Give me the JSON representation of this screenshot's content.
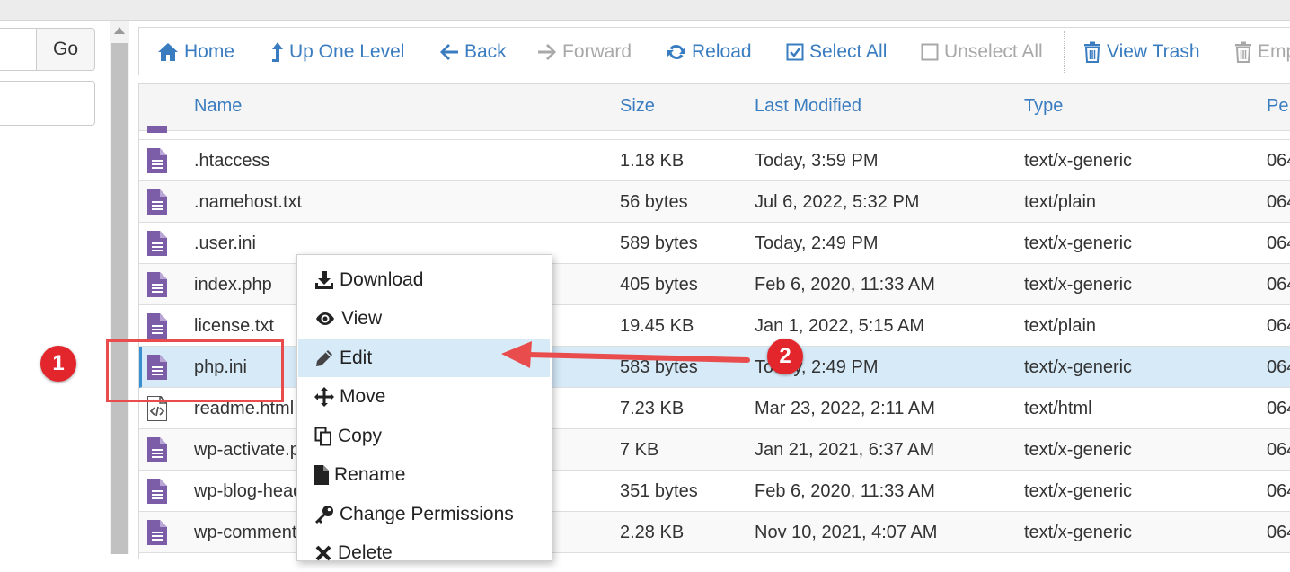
{
  "left_panel": {
    "go_label": "Go"
  },
  "toolbar": {
    "items": [
      {
        "label": "Home",
        "icon": "home-icon",
        "enabled": true
      },
      {
        "label": "Up One Level",
        "icon": "up-level-icon",
        "enabled": true
      },
      {
        "label": "Back",
        "icon": "back-arrow-icon",
        "enabled": true
      },
      {
        "label": "Forward",
        "icon": "forward-arrow-icon",
        "enabled": false
      },
      {
        "label": "Reload",
        "icon": "reload-icon",
        "enabled": true
      },
      {
        "label": "Select All",
        "icon": "checked-box-icon",
        "enabled": true
      },
      {
        "label": "Unselect All",
        "icon": "empty-box-icon",
        "enabled": false
      },
      {
        "label": "View Trash",
        "icon": "trash-icon",
        "enabled": true
      },
      {
        "label": "Emp",
        "icon": "trash-icon",
        "enabled": false
      }
    ]
  },
  "table": {
    "columns": [
      "Name",
      "Size",
      "Last Modified",
      "Type",
      "Pe"
    ],
    "rows": [
      {
        "name": ".htaccess",
        "size": "1.18 KB",
        "modified": "Today, 3:59 PM",
        "type": "text/x-generic",
        "perms": "064",
        "icon": "text-file-icon"
      },
      {
        "name": ".namehost.txt",
        "size": "56 bytes",
        "modified": "Jul 6, 2022, 5:32 PM",
        "type": "text/plain",
        "perms": "064",
        "icon": "text-file-icon"
      },
      {
        "name": ".user.ini",
        "size": "589 bytes",
        "modified": "Today, 2:49 PM",
        "type": "text/x-generic",
        "perms": "064",
        "icon": "text-file-icon"
      },
      {
        "name": "index.php",
        "size": "405 bytes",
        "modified": "Feb 6, 2020, 11:33 AM",
        "type": "text/x-generic",
        "perms": "064",
        "icon": "text-file-icon"
      },
      {
        "name": "license.txt",
        "size": "19.45 KB",
        "modified": "Jan 1, 2022, 5:15 AM",
        "type": "text/plain",
        "perms": "064",
        "icon": "text-file-icon"
      },
      {
        "name": "php.ini",
        "size": "583 bytes",
        "modified": "Today, 2:49 PM",
        "type": "text/x-generic",
        "perms": "064",
        "icon": "text-file-icon",
        "selected": true
      },
      {
        "name": "readme.html",
        "size": "7.23 KB",
        "modified": "Mar 23, 2022, 2:11 AM",
        "type": "text/html",
        "perms": "064",
        "icon": "html-file-icon"
      },
      {
        "name": "wp-activate.php",
        "size": "7 KB",
        "modified": "Jan 21, 2021, 6:37 AM",
        "type": "text/x-generic",
        "perms": "064",
        "icon": "text-file-icon"
      },
      {
        "name": "wp-blog-header.php",
        "size": "351 bytes",
        "modified": "Feb 6, 2020, 11:33 AM",
        "type": "text/x-generic",
        "perms": "064",
        "icon": "text-file-icon"
      },
      {
        "name": "wp-comments-post.php",
        "size": "2.28 KB",
        "modified": "Nov 10, 2021, 4:07 AM",
        "type": "text/x-generic",
        "perms": "064",
        "icon": "text-file-icon"
      }
    ]
  },
  "context_menu": {
    "items": [
      {
        "label": "Download",
        "icon": "download-icon"
      },
      {
        "label": "View",
        "icon": "eye-icon"
      },
      {
        "label": "Edit",
        "icon": "pencil-icon",
        "active": true
      },
      {
        "label": "Move",
        "icon": "move-icon"
      },
      {
        "label": "Copy",
        "icon": "copy-icon"
      },
      {
        "label": "Rename",
        "icon": "file-icon"
      },
      {
        "label": "Change Permissions",
        "icon": "key-icon"
      },
      {
        "label": "Delete",
        "icon": "delete-icon"
      }
    ]
  },
  "annotations": {
    "step1": "1",
    "step2": "2",
    "accent_color": "#e3262c"
  },
  "colors": {
    "link_blue": "#3a7cc0",
    "file_icon_purple": "#7b5ea7",
    "selected_row": "#d6eaf8"
  }
}
